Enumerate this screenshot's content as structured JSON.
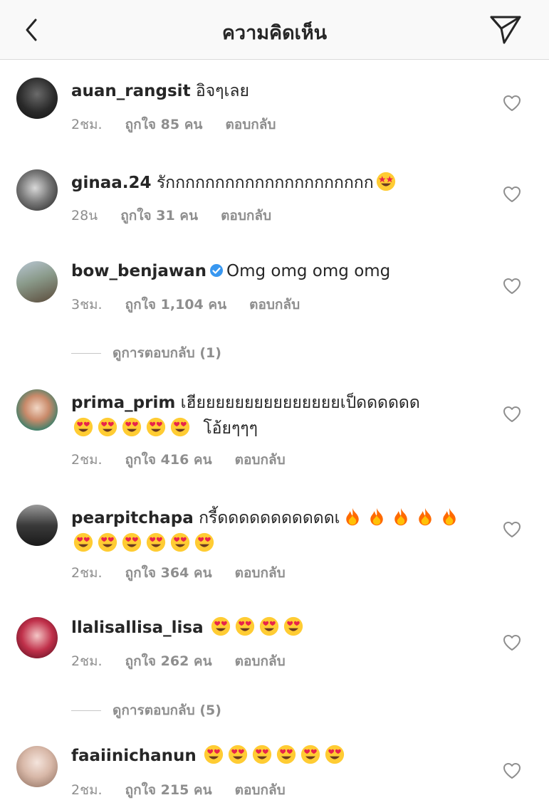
{
  "header": {
    "title": "ความคิดเห็น"
  },
  "icons": {
    "back": "chevron-left-icon",
    "send": "send-icon",
    "heart": "heart-outline-icon",
    "verified": "verified-badge-icon",
    "emoji_heart_eyes": "heart-eyes-emoji",
    "emoji_star_struck": "star-struck-emoji",
    "emoji_fire": "fire-emoji"
  },
  "colors": {
    "verified_blue": "#3897f0",
    "meta_gray": "#8e8e8e",
    "text": "#262626",
    "header_bg": "#f9f9f9"
  },
  "comments": [
    {
      "username": "auan_rangsit",
      "text": "อิจๆเลย",
      "time": "2ชม.",
      "likes": "ถูกใจ 85 คน",
      "reply": "ตอบกลับ"
    },
    {
      "username": "ginaa.24",
      "text": "รักกกกกกกกกกกกกกกกกกกกก",
      "time": "28น",
      "likes": "ถูกใจ 31 คน",
      "reply": "ตอบกลับ"
    },
    {
      "username": "bow_benjawan",
      "text": "Omg omg omg omg",
      "time": "3ชม.",
      "likes": "ถูกใจ 1,104 คน",
      "reply": "ตอบกลับ",
      "view_replies": "ดูการตอบกลับ (1)"
    },
    {
      "username": "prima_prim",
      "text": "เฮียยยยยยยยยยยยยยยเป็ดดดดดด",
      "text2": "โอ้ยๆๆๆ",
      "time": "2ชม.",
      "likes": "ถูกใจ 416 คน",
      "reply": "ตอบกลับ"
    },
    {
      "username": "pearpitchapa",
      "text": "กรี้ดดดดดดดดดดดเ",
      "time": "2ชม.",
      "likes": "ถูกใจ 364 คน",
      "reply": "ตอบกลับ"
    },
    {
      "username": "llalisallisa_lisa",
      "text": "",
      "time": "2ชม.",
      "likes": "ถูกใจ 262 คน",
      "reply": "ตอบกลับ",
      "view_replies": "ดูการตอบกลับ (5)"
    },
    {
      "username": "faaiinichanun",
      "text": "",
      "time": "2ชม.",
      "likes": "ถูกใจ 215 คน",
      "reply": "ตอบกลับ"
    }
  ]
}
